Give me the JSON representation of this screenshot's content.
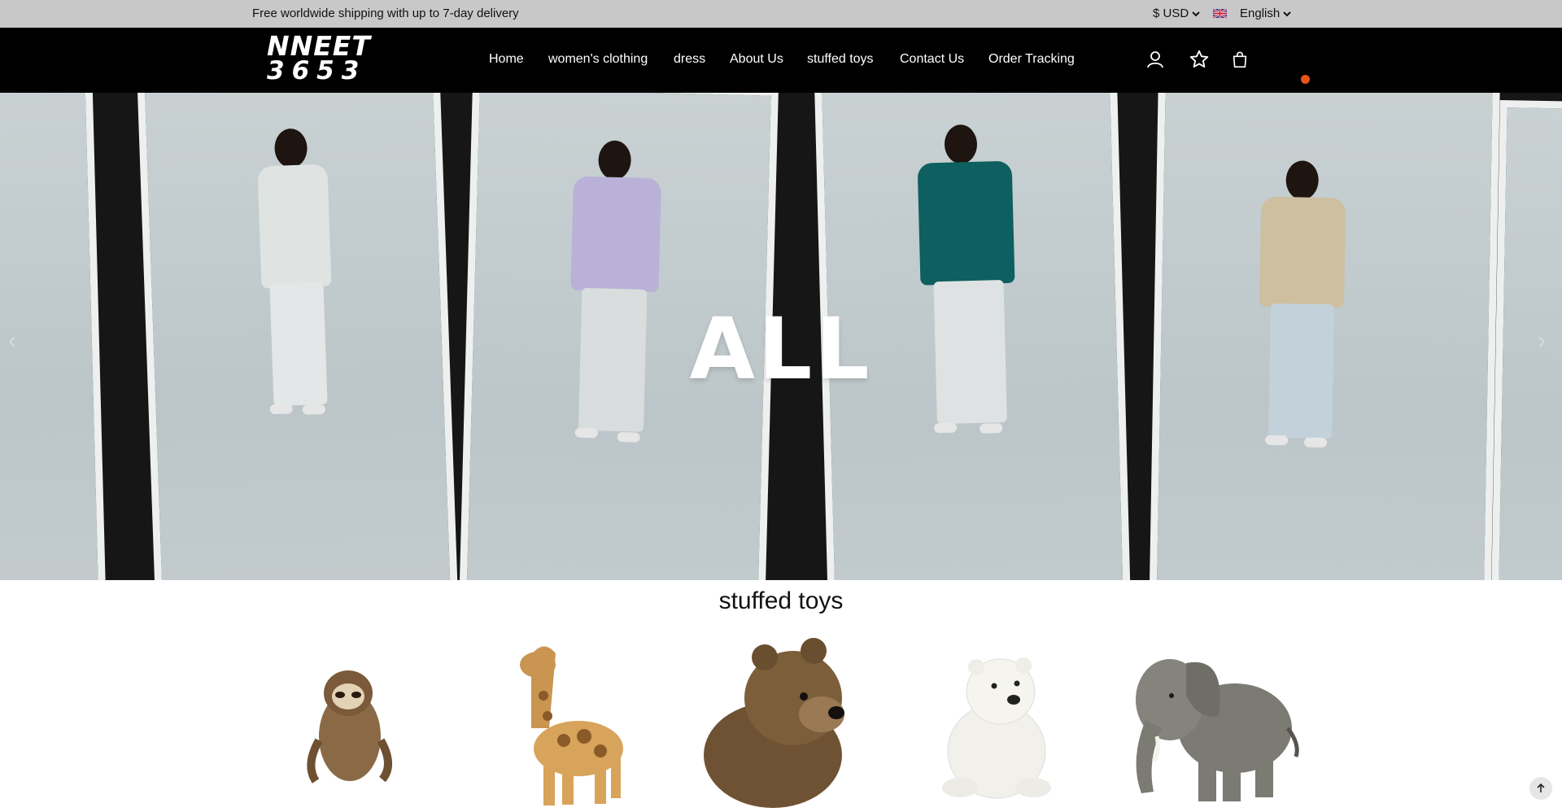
{
  "announcement": {
    "text": "Free worldwide shipping with up to 7-day delivery"
  },
  "currency": {
    "label": "$ USD"
  },
  "language": {
    "label": "English",
    "flag": "uk-flag-icon"
  },
  "header": {
    "logo_line1": "NNEET",
    "logo_line2": "3653",
    "nav": [
      {
        "label": "Home"
      },
      {
        "label": "women's clothing"
      },
      {
        "label": "dress"
      },
      {
        "label": "About Us"
      },
      {
        "label": "stuffed toys"
      },
      {
        "label": "Contact Us"
      },
      {
        "label": "Order Tracking"
      }
    ],
    "icons": [
      "account-icon",
      "wishlist-star-icon",
      "cart-bag-icon"
    ]
  },
  "hero": {
    "headline": "ALL"
  },
  "section": {
    "title": "stuffed toys",
    "products": [
      {
        "name": "sloth-plush",
        "icon": "sloth-toy-image"
      },
      {
        "name": "giraffe-plush",
        "icon": "giraffe-toy-image"
      },
      {
        "name": "brown-bear-plush",
        "icon": "brown-bear-toy-image"
      },
      {
        "name": "polar-bear-plush",
        "icon": "polar-bear-toy-image"
      },
      {
        "name": "elephant-plush",
        "icon": "elephant-toy-image"
      }
    ]
  },
  "colors": {
    "topbar": "#c8c8c8",
    "header": "#000000",
    "badge": "#e8541a"
  }
}
